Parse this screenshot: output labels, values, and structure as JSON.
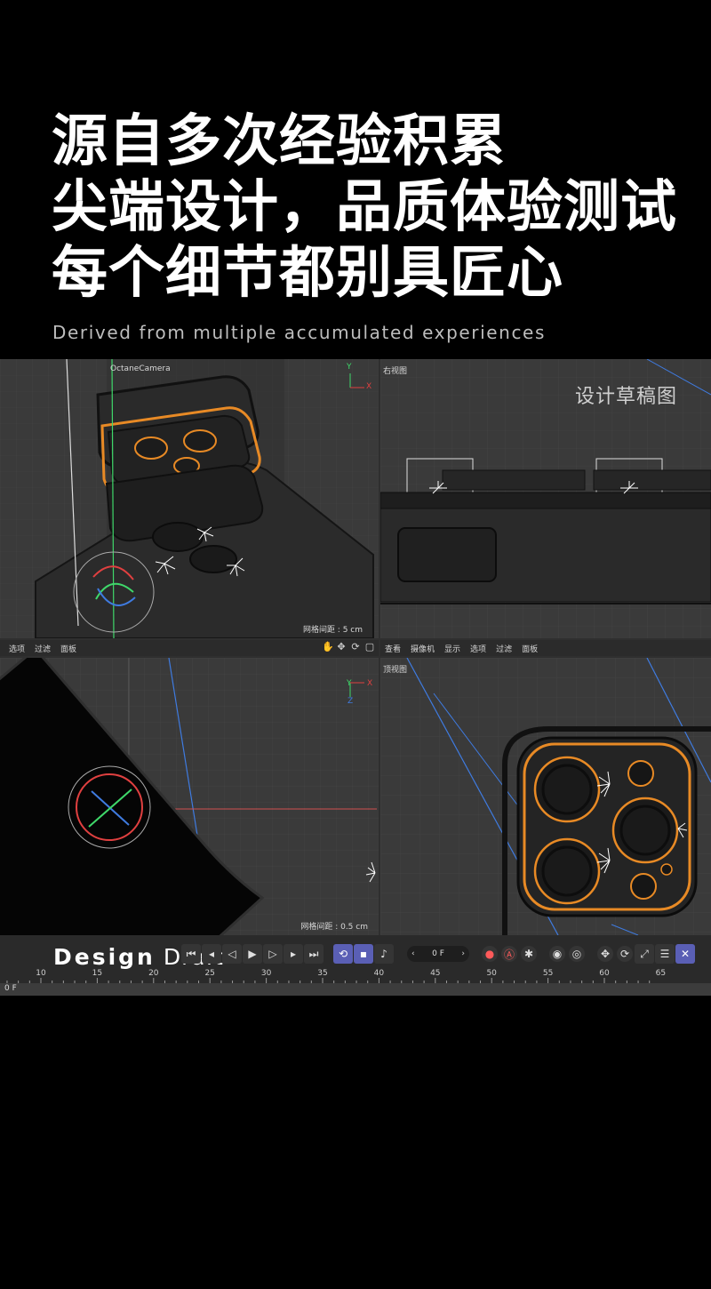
{
  "headline": {
    "line1": "源自多次经验积累",
    "line2": "尖端设计，品质体验测试",
    "line3": "每个细节都别具匠心"
  },
  "subtitle": "Derived from multiple accumulated experiences",
  "viewports": {
    "perspective": {
      "camera_label": "OctaneCamera",
      "grid_spacing": "网格间距 : 5 cm",
      "axis_y": "Y",
      "axis_x": "X"
    },
    "right": {
      "label": "右视图",
      "draft_title": "设计草稿图"
    },
    "front": {
      "grid_spacing": "网格间距 : 0.5 cm",
      "axis_y": "Y",
      "axis_x": "X",
      "axis_z": "Z"
    },
    "top": {
      "label": "顶视图"
    }
  },
  "menubar_left": [
    "选项",
    "过滤",
    "面板"
  ],
  "menubar_right": [
    "查看",
    "摄像机",
    "显示",
    "选项",
    "过滤",
    "面板"
  ],
  "timeline": {
    "watermark_bold": "Design",
    "watermark_light": "Draft",
    "frame_value": "0 F",
    "current_frame": "0 F",
    "ticks": [
      "10",
      "15",
      "20",
      "25",
      "30",
      "35",
      "40",
      "45",
      "50",
      "55",
      "60",
      "65"
    ]
  },
  "colors": {
    "orange": "#e88a25",
    "blue_line": "#3f7be0",
    "axis_red": "#e04040",
    "axis_green": "#3fd86a",
    "ui_blue": "#5a5fb5"
  },
  "icons": {
    "hand": "hand-icon",
    "move": "move-icon",
    "rotate": "rotate-icon",
    "maximize": "maximize-icon",
    "first": "go-to-start-icon",
    "prev_key": "prev-key-icon",
    "prev_frame": "prev-frame-icon",
    "play": "play-icon",
    "next_frame": "next-frame-icon",
    "next_key": "next-key-icon",
    "last": "go-to-end-icon"
  }
}
